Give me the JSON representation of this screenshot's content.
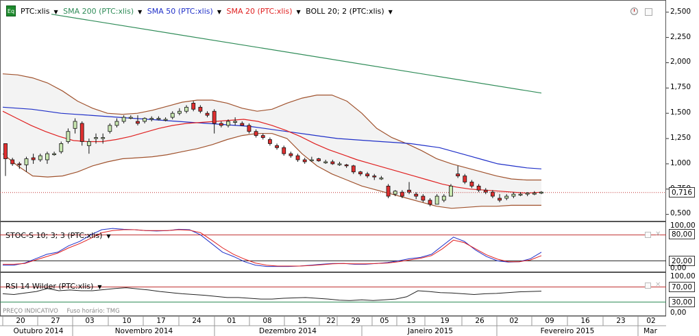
{
  "legend": {
    "symbol": "PTC:xlis",
    "sma200": "SMA 200 (PTC:xlis)",
    "sma50": "SMA 50 (PTC:xlis)",
    "sma20": "SMA 20 (PTC:xlis)",
    "boll": "BOLL 20; 2 (PTC:xlis)",
    "eq_badge": "Eq"
  },
  "price_axis": [
    "2,500",
    "2,250",
    "2,000",
    "1,750",
    "1,500",
    "1,250",
    "1,000",
    "0,750",
    "0,500"
  ],
  "last_price": "0,716",
  "stoch": {
    "label": "STOC-S 10; 3; 3 (PTC:xlis)",
    "axis": [
      "100,00",
      "80,00",
      "20,00",
      "0,00"
    ]
  },
  "rsi": {
    "label": "RSI 14 Wilder (PTC:xlis)",
    "axis": [
      "100,00",
      "70,00",
      "30,00",
      "0,00"
    ]
  },
  "footer": {
    "note1": "PREÇO INDICATIVO",
    "note2": "Fuso horário: TMG"
  },
  "date_axis": {
    "days": [
      "20",
      "27",
      "03",
      "10",
      "17",
      "24",
      "01",
      "08",
      "15",
      "22",
      "29",
      "05",
      "13",
      "19",
      "26",
      "02",
      "09",
      "16",
      "23",
      "02"
    ],
    "months": [
      "Outubro 2014",
      "Novembro 2014",
      "Dezembro 2014",
      "Janeiro 2015",
      "Fevereiro 2015",
      "Mar"
    ]
  },
  "colors": {
    "sma200": "#2e8b57",
    "sma50": "#1f2fc8",
    "sma20": "#e02020",
    "boll": "#a0522d",
    "up": "#c8e6b0",
    "down": "#e03030"
  },
  "chart_data": {
    "type": "candlestick",
    "ylim": [
      0.45,
      2.6
    ],
    "candles": [
      [
        1.2,
        1.2,
        0.88,
        1.05
      ],
      [
        1.04,
        1.06,
        0.98,
        1.0
      ],
      [
        1.0,
        1.02,
        0.95,
        0.99
      ],
      [
        0.99,
        1.07,
        0.92,
        1.05
      ],
      [
        1.06,
        1.1,
        1.0,
        1.04
      ],
      [
        1.04,
        1.1,
        1.02,
        1.08
      ],
      [
        1.04,
        1.12,
        1.0,
        1.1
      ],
      [
        1.1,
        1.12,
        1.08,
        1.1
      ],
      [
        1.12,
        1.22,
        1.1,
        1.2
      ],
      [
        1.22,
        1.35,
        1.2,
        1.32
      ],
      [
        1.35,
        1.45,
        1.3,
        1.42
      ],
      [
        1.4,
        1.42,
        1.18,
        1.22
      ],
      [
        1.18,
        1.25,
        1.1,
        1.22
      ],
      [
        1.26,
        1.3,
        1.2,
        1.26
      ],
      [
        1.25,
        1.3,
        1.2,
        1.26
      ],
      [
        1.32,
        1.4,
        1.3,
        1.38
      ],
      [
        1.38,
        1.45,
        1.36,
        1.42
      ],
      [
        1.42,
        1.48,
        1.4,
        1.46
      ],
      [
        1.46,
        1.48,
        1.44,
        1.46
      ],
      [
        1.42,
        1.48,
        1.38,
        1.4
      ],
      [
        1.42,
        1.46,
        1.4,
        1.45
      ],
      [
        1.44,
        1.47,
        1.42,
        1.45
      ],
      [
        1.45,
        1.47,
        1.43,
        1.45
      ],
      [
        1.44,
        1.46,
        1.42,
        1.44
      ],
      [
        1.46,
        1.52,
        1.44,
        1.5
      ],
      [
        1.5,
        1.55,
        1.48,
        1.52
      ],
      [
        1.52,
        1.58,
        1.5,
        1.56
      ],
      [
        1.6,
        1.62,
        1.52,
        1.54
      ],
      [
        1.56,
        1.58,
        1.5,
        1.52
      ],
      [
        1.5,
        1.52,
        1.46,
        1.48
      ],
      [
        1.52,
        1.54,
        1.3,
        1.4
      ],
      [
        1.4,
        1.42,
        1.36,
        1.38
      ],
      [
        1.38,
        1.44,
        1.36,
        1.42
      ],
      [
        1.42,
        1.46,
        1.38,
        1.42
      ],
      [
        1.4,
        1.42,
        1.38,
        1.38
      ],
      [
        1.38,
        1.4,
        1.3,
        1.32
      ],
      [
        1.32,
        1.34,
        1.26,
        1.28
      ],
      [
        1.28,
        1.3,
        1.24,
        1.26
      ],
      [
        1.24,
        1.26,
        1.18,
        1.2
      ],
      [
        1.18,
        1.2,
        1.14,
        1.16
      ],
      [
        1.16,
        1.18,
        1.08,
        1.1
      ],
      [
        1.1,
        1.12,
        1.06,
        1.08
      ],
      [
        1.08,
        1.1,
        1.02,
        1.04
      ],
      [
        1.04,
        1.06,
        1.0,
        1.02
      ],
      [
        1.04,
        1.07,
        1.02,
        1.04
      ],
      [
        1.05,
        1.06,
        1.02,
        1.03
      ],
      [
        1.02,
        1.04,
        1.0,
        1.02
      ],
      [
        1.02,
        1.04,
        0.99,
        1.0
      ],
      [
        1.0,
        1.02,
        0.98,
        1.0
      ],
      [
        0.99,
        1.0,
        0.96,
        0.98
      ],
      [
        0.98,
        0.99,
        0.9,
        0.92
      ],
      [
        0.92,
        0.93,
        0.88,
        0.9
      ],
      [
        0.9,
        0.92,
        0.86,
        0.88
      ],
      [
        0.88,
        0.9,
        0.84,
        0.87
      ],
      [
        0.86,
        0.88,
        0.84,
        0.86
      ],
      [
        0.78,
        0.8,
        0.66,
        0.68
      ],
      [
        0.7,
        0.74,
        0.68,
        0.73
      ],
      [
        0.72,
        0.74,
        0.66,
        0.68
      ],
      [
        0.74,
        0.82,
        0.7,
        0.72
      ],
      [
        0.7,
        0.72,
        0.65,
        0.68
      ],
      [
        0.68,
        0.7,
        0.62,
        0.64
      ],
      [
        0.64,
        0.66,
        0.58,
        0.6
      ],
      [
        0.6,
        0.7,
        0.6,
        0.68
      ],
      [
        0.64,
        0.7,
        0.62,
        0.68
      ],
      [
        0.68,
        0.8,
        0.68,
        0.78
      ],
      [
        0.9,
        0.98,
        0.86,
        0.88
      ],
      [
        0.88,
        0.9,
        0.8,
        0.82
      ],
      [
        0.82,
        0.84,
        0.76,
        0.78
      ],
      [
        0.78,
        0.8,
        0.72,
        0.74
      ],
      [
        0.74,
        0.76,
        0.7,
        0.72
      ],
      [
        0.72,
        0.74,
        0.66,
        0.68
      ],
      [
        0.66,
        0.7,
        0.62,
        0.64
      ],
      [
        0.66,
        0.7,
        0.64,
        0.68
      ],
      [
        0.68,
        0.72,
        0.66,
        0.7
      ],
      [
        0.7,
        0.72,
        0.68,
        0.7
      ],
      [
        0.7,
        0.72,
        0.68,
        0.71
      ],
      [
        0.71,
        0.73,
        0.69,
        0.71
      ],
      [
        0.71,
        0.73,
        0.7,
        0.72
      ]
    ],
    "sma200": [
      [
        0,
        2.48
      ],
      [
        100,
        1.7
      ]
    ],
    "sma50": [
      1.56,
      1.55,
      1.54,
      1.52,
      1.5,
      1.49,
      1.48,
      1.47,
      1.46,
      1.45,
      1.44,
      1.43,
      1.42,
      1.41,
      1.4,
      1.39,
      1.38,
      1.37,
      1.35,
      1.33,
      1.31,
      1.29,
      1.27,
      1.25,
      1.24,
      1.23,
      1.22,
      1.21,
      1.2,
      1.18,
      1.16,
      1.12,
      1.08,
      1.04,
      1.0,
      0.98,
      0.96,
      0.95
    ],
    "sma20": [
      1.52,
      1.45,
      1.38,
      1.32,
      1.27,
      1.23,
      1.22,
      1.22,
      1.24,
      1.27,
      1.31,
      1.35,
      1.38,
      1.4,
      1.41,
      1.42,
      1.43,
      1.44,
      1.42,
      1.38,
      1.33,
      1.27,
      1.2,
      1.14,
      1.09,
      1.04,
      1.0,
      0.96,
      0.92,
      0.88,
      0.84,
      0.8,
      0.77,
      0.75,
      0.74,
      0.73,
      0.72,
      0.71,
      0.72
    ],
    "boll_upper": [
      1.89,
      1.88,
      1.85,
      1.8,
      1.72,
      1.62,
      1.55,
      1.5,
      1.49,
      1.5,
      1.53,
      1.57,
      1.61,
      1.63,
      1.63,
      1.6,
      1.55,
      1.52,
      1.54,
      1.6,
      1.65,
      1.68,
      1.68,
      1.62,
      1.5,
      1.35,
      1.26,
      1.2,
      1.13,
      1.05,
      1.0,
      0.96,
      0.92,
      0.88,
      0.85,
      0.84,
      0.84
    ],
    "boll_lower": [
      1.1,
      0.98,
      0.88,
      0.87,
      0.88,
      0.92,
      0.98,
      1.02,
      1.05,
      1.06,
      1.07,
      1.09,
      1.12,
      1.15,
      1.19,
      1.24,
      1.28,
      1.3,
      1.3,
      1.25,
      1.1,
      0.98,
      0.9,
      0.84,
      0.78,
      0.74,
      0.7,
      0.66,
      0.62,
      0.58,
      0.56,
      0.57,
      0.58,
      0.58,
      0.59,
      0.59,
      0.59
    ],
    "stoch_k": [
      10,
      10,
      15,
      25,
      35,
      40,
      55,
      65,
      80,
      92,
      95,
      93,
      92,
      90,
      89,
      90,
      93,
      92,
      80,
      60,
      40,
      30,
      18,
      10,
      7,
      7,
      7,
      8,
      10,
      12,
      14,
      14,
      12,
      12,
      14,
      16,
      20,
      25,
      28,
      35,
      55,
      75,
      65,
      45,
      30,
      20,
      17,
      18,
      25,
      40
    ],
    "stoch_d": [
      12,
      12,
      14,
      22,
      30,
      38,
      50,
      60,
      72,
      85,
      90,
      92,
      92,
      90,
      90,
      90,
      92,
      91,
      85,
      68,
      50,
      35,
      24,
      15,
      10,
      8,
      8,
      8,
      9,
      11,
      13,
      14,
      13,
      13,
      14,
      15,
      18,
      22,
      26,
      32,
      48,
      68,
      62,
      48,
      34,
      24,
      18,
      18,
      22,
      32
    ],
    "rsi": [
      52,
      50,
      54,
      58,
      66,
      60,
      62,
      60,
      60,
      63,
      66,
      68,
      65,
      62,
      58,
      55,
      52,
      50,
      48,
      45,
      42,
      42,
      40,
      38,
      38,
      40,
      41,
      42,
      40,
      38,
      35,
      34,
      36,
      34,
      36,
      38,
      44,
      60,
      58,
      55,
      54,
      52,
      50,
      52,
      53,
      55,
      57,
      58,
      59
    ]
  }
}
